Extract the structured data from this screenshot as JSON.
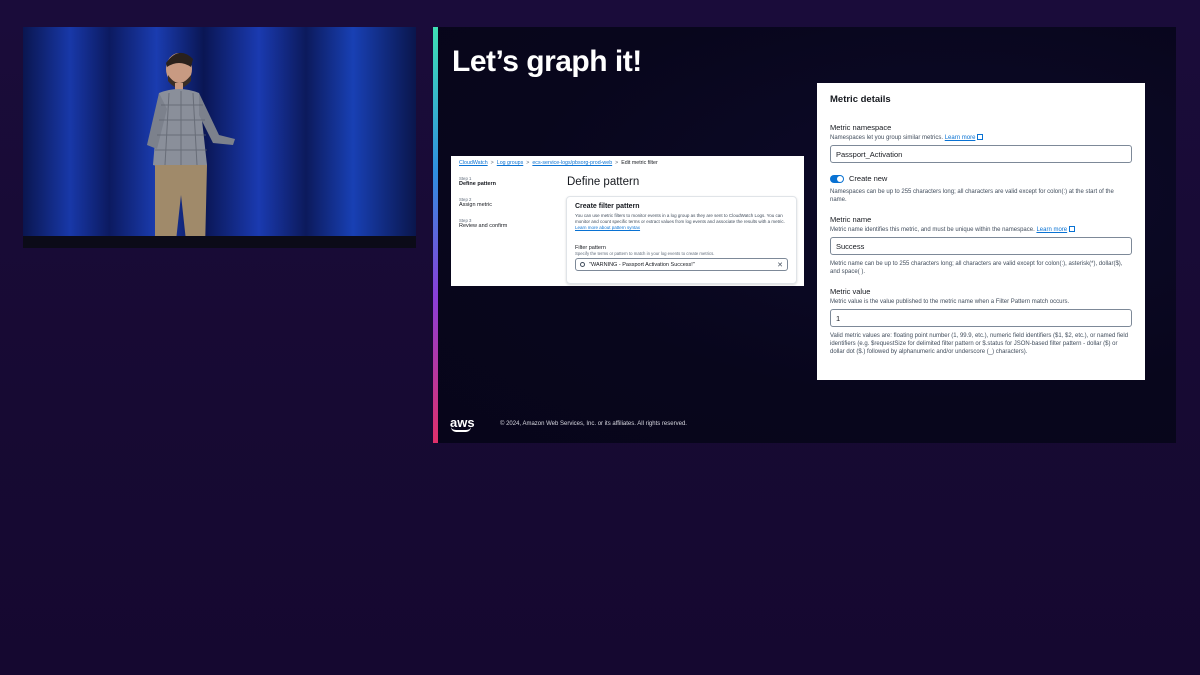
{
  "slide": {
    "title": "Let’s graph it!",
    "logo_text": "aws",
    "copyright": "© 2024, Amazon Web Services, Inc. or its affiliates. All rights reserved."
  },
  "console": {
    "breadcrumbs": [
      "CloudWatch",
      "Log groups",
      "ecs-service-logs/pbsorg-prod-web",
      "Edit metric filter"
    ],
    "steps": [
      {
        "num": "Step 1",
        "label": "Define pattern"
      },
      {
        "num": "Step 2",
        "label": "Assign metric"
      },
      {
        "num": "Step 3",
        "label": "Review and confirm"
      }
    ],
    "page_title": "Define pattern",
    "card_title": "Create filter pattern",
    "card_desc": "You can use metric filters to monitor events in a log group as they are sent to CloudWatch Logs. You can monitor and count specific terms or extract values from log events and associate the results with a metric.",
    "card_link": "Learn more about pattern syntax",
    "filter_label": "Filter pattern",
    "filter_help": "Specify the terms or pattern to match in your log events to create metrics.",
    "filter_value": "\"WARNING - Passport Activation Success!\""
  },
  "metric": {
    "title": "Metric details",
    "namespace_label": "Metric namespace",
    "namespace_help": "Namespaces let you group similar metrics.",
    "learn_more": "Learn more",
    "namespace_value": "Passport_Activation",
    "create_new_label": "Create new",
    "create_new_on": true,
    "namespace_rules": "Namespaces can be up to 255 characters long; all characters are valid except for colon(:) at the start of the name.",
    "name_label": "Metric name",
    "name_help": "Metric name identifies this metric, and must be unique within the namespace.",
    "name_value": "Success",
    "name_rules": "Metric name can be up to 255 characters long; all characters are valid except for colon(:), asterisk(*), dollar($), and space( ).",
    "value_label": "Metric value",
    "value_help": "Metric value is the value published to the metric name when a Filter Pattern match occurs.",
    "value_value": "1",
    "value_rules": "Valid metric values are: floating point number (1, 99.9, etc.), numeric field identifiers ($1, $2, etc.), or named field identifiers (e.g. $requestSize for delimited filter pattern or $.status for JSON-based filter pattern - dollar ($) or dollar dot ($.) followed by alphanumeric and/or underscore (_) characters)."
  },
  "colors": {
    "link": "#0972d3",
    "toggle_on": "#0972d3",
    "background": "#170a33"
  }
}
